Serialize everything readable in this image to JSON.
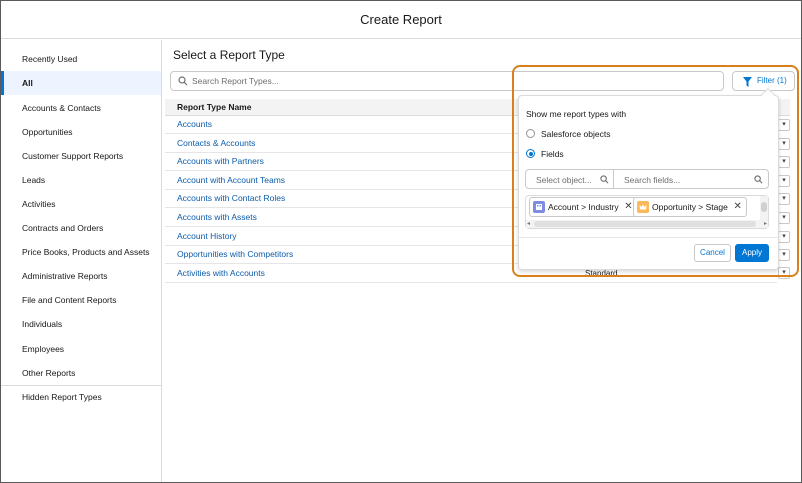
{
  "window": {
    "title": "Create Report"
  },
  "sidebar": {
    "items": [
      {
        "label": "Recently Used"
      },
      {
        "label": "All",
        "active": true
      },
      {
        "label": "Accounts & Contacts"
      },
      {
        "label": "Opportunities"
      },
      {
        "label": "Customer Support Reports"
      },
      {
        "label": "Leads"
      },
      {
        "label": "Activities"
      },
      {
        "label": "Contracts and Orders"
      },
      {
        "label": "Price Books, Products and Assets"
      },
      {
        "label": "Administrative Reports"
      },
      {
        "label": "File and Content Reports"
      },
      {
        "label": "Individuals"
      },
      {
        "label": "Employees"
      },
      {
        "label": "Other Reports"
      },
      {
        "label": "Hidden Report Types"
      }
    ]
  },
  "main": {
    "title": "Select a Report Type",
    "search_placeholder": "Search Report Types...",
    "filter_label": "Filter (1)",
    "column_header": "Report Type Name",
    "rows": [
      {
        "name": "Accounts"
      },
      {
        "name": "Contacts & Accounts"
      },
      {
        "name": "Accounts with Partners"
      },
      {
        "name": "Account with Account Teams"
      },
      {
        "name": "Accounts with Contact Roles"
      },
      {
        "name": "Accounts with Assets"
      },
      {
        "name": "Account History"
      },
      {
        "name": "Opportunities with Competitors"
      },
      {
        "name": "Activities with Accounts",
        "category": "Standard"
      }
    ]
  },
  "filter_popover": {
    "heading": "Show me report types with",
    "options": [
      {
        "label": "Salesforce objects",
        "selected": false
      },
      {
        "label": "Fields",
        "selected": true
      }
    ],
    "object_placeholder": "Select object...",
    "fields_placeholder": "Search fields...",
    "pills": [
      {
        "label": "Account > Industry",
        "icon": "account-icon",
        "color": "#7f8de1"
      },
      {
        "label": "Opportunity > Stage",
        "icon": "opportunity-icon",
        "color": "#fcb95b"
      }
    ],
    "cancel_label": "Cancel",
    "apply_label": "Apply"
  },
  "colors": {
    "brand": "#0176d3",
    "highlight": "#d9801c",
    "link": "#0b5cab"
  }
}
